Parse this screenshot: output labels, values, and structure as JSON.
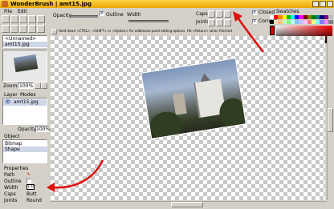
{
  "window": {
    "title": "WonderBrush | amt15.jpg"
  },
  "menu": {
    "file": "File",
    "edit": "Edit"
  },
  "toolbar": {
    "opacity_label": "Opacity",
    "outline_label": "Outline",
    "width_label": "Width",
    "caps_label": "Caps",
    "joints_label": "Joints",
    "closed_label": "Closed",
    "corners_label": "Corners",
    "outline_checked": true,
    "closed_checked": true,
    "corners_checked": true
  },
  "help_bar": {
    "text": "Hold down <CTRL>, <SHIFT> or <Option> for additional point editing options. Hit <Return> when finished."
  },
  "swatches": {
    "label": "Swatches",
    "colors_row1": [
      "#ffffff",
      "#ff0000",
      "#ff8000",
      "#ffff00",
      "#00c000",
      "#00ffff",
      "#0000ff",
      "#ff00ff",
      "#800000",
      "#808000",
      "#008000",
      "#008080",
      "#000080",
      "#800080",
      "#c0c0c0"
    ],
    "colors_row2": [
      "#000000",
      "#ffe0c0",
      "#ffc080",
      "#c0ffc0",
      "#80ff80",
      "#c0ffff",
      "#80c0ff",
      "#c0c0ff",
      "#ffc0ff",
      "#ff8080",
      "#ffff80",
      "#80ffff",
      "#8080ff",
      "#ff80ff",
      "#808080"
    ],
    "current_color": "#d00000"
  },
  "left": {
    "documents": [
      "<Unnamed>",
      "amt15.jpg"
    ],
    "zoom_label": "Zoom",
    "zoom_value": "100%",
    "layer_tab": "Layer",
    "modes_tab": "Modes",
    "layer_name": "amt15.jpg",
    "opacity_label": "Opacity",
    "opacity_value": "100%",
    "object_tab": "Object",
    "objects": [
      "Bitmap",
      "Shape"
    ],
    "properties_label": "Properties",
    "props": [
      {
        "name": "Path",
        "value": ""
      },
      {
        "name": "Outline",
        "value": ""
      },
      {
        "name": "Width",
        "value": "1.0"
      },
      {
        "name": "Caps",
        "value": "Butt"
      },
      {
        "name": "Joints",
        "value": "Round"
      }
    ]
  },
  "annotation_color": "#e01010"
}
